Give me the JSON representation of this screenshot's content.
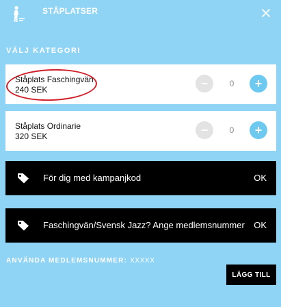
{
  "header": {
    "title": "STÅPLATSER",
    "icon": "standing-person-icon",
    "close_icon": "close-icon"
  },
  "category_label": "VÄLJ KATEGORI",
  "tickets": [
    {
      "name": "Ståplats Faschingvän",
      "price": "240 SEK",
      "quantity": "0",
      "minus": "−",
      "plus": "+"
    },
    {
      "name": "Ståplats Ordinarie",
      "price": "320 SEK",
      "quantity": "0",
      "minus": "−",
      "plus": "+"
    }
  ],
  "promos": [
    {
      "label": "För dig med kampanjkod",
      "action": "OK",
      "icon": "tag-icon"
    },
    {
      "label": "Faschingvän/Svensk Jazz? Ange medlemsnummer",
      "action": "OK",
      "icon": "tag-icon"
    }
  ],
  "members": {
    "label": "ANVÄNDA MEDLEMSNUMMER:",
    "value": "XXXXX"
  },
  "add_button": "LÄGG TILL",
  "colors": {
    "background": "#8fd4f5",
    "accent": "#6ec9f0",
    "promo_bar": "#000000",
    "highlight": "#d0202a"
  }
}
